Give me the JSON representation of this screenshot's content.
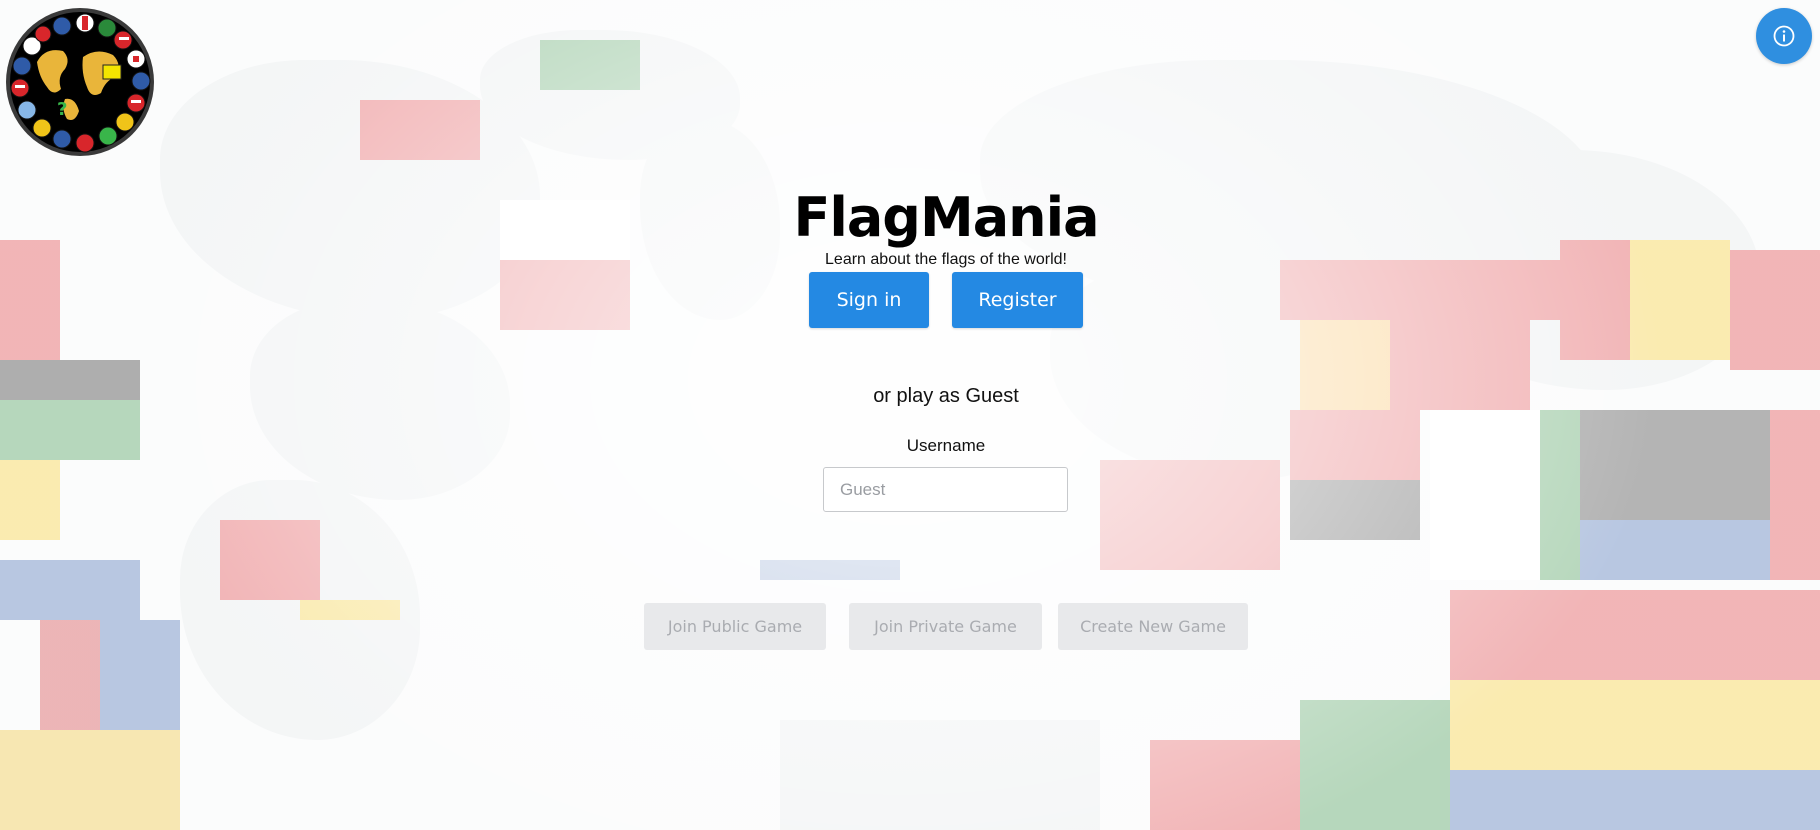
{
  "app": {
    "title": "FlagMania",
    "subtitle": "Learn about the flags of the world!"
  },
  "auth": {
    "signin_label": "Sign in",
    "register_label": "Register"
  },
  "guest": {
    "prompt": "or play as Guest",
    "username_label": "Username",
    "username_placeholder": "Guest",
    "username_value": ""
  },
  "game_actions": {
    "join_public_label": "Join Public Game",
    "join_private_label": "Join Private Game",
    "create_new_label": "Create New Game"
  },
  "icons": {
    "info": "info-icon",
    "logo": "flag-globe-logo"
  },
  "colors": {
    "primary": "#2489e3",
    "info_button": "#2f8fe0",
    "disabled_button_bg": "#e7e8ea",
    "disabled_button_text": "#a3a6ab"
  }
}
